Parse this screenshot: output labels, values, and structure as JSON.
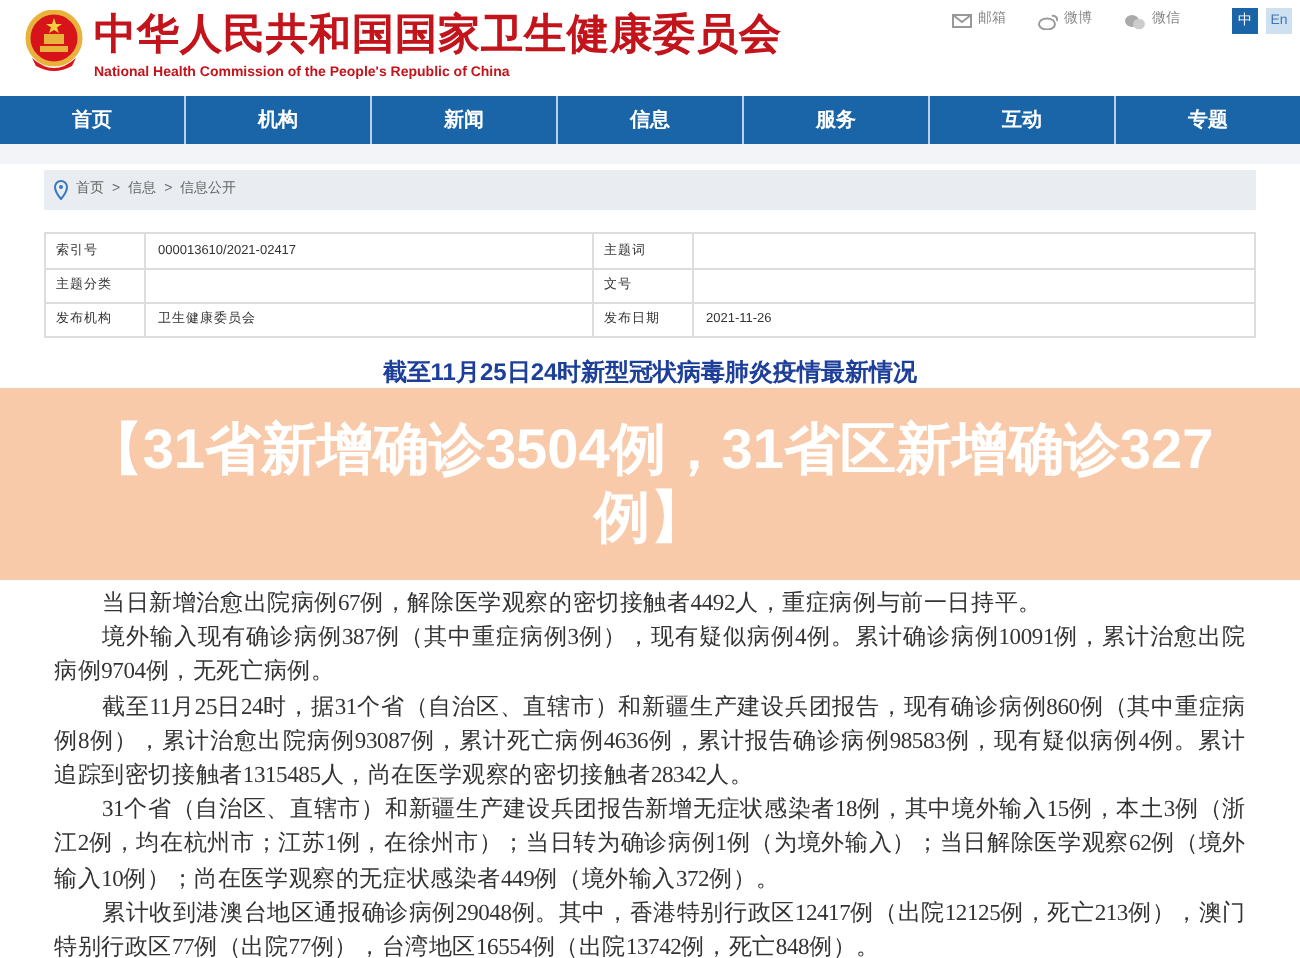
{
  "header": {
    "title": "中华人民共和国国家卫生健康委员会",
    "subtitle": "National Health Commission of the People's Republic of China",
    "links": [
      {
        "kind": "mail",
        "label": "邮箱"
      },
      {
        "kind": "weibo",
        "label": "微博"
      },
      {
        "kind": "wechat",
        "label": "微信"
      }
    ],
    "languages": [
      {
        "label": "中",
        "selected": true
      },
      {
        "label": "En",
        "selected": false
      }
    ]
  },
  "nav": [
    "首页",
    "机构",
    "新闻",
    "信息",
    "服务",
    "互动",
    "专题"
  ],
  "breadcrumb": {
    "separator": ">",
    "items": [
      "首页",
      "信息",
      "信息公开"
    ]
  },
  "meta_table": [
    [
      {
        "label": "索引号",
        "value": "000013610/2021-02417"
      },
      {
        "label": "主题词"
      }
    ],
    [
      {
        "label": "主题分类"
      },
      {
        "label": "文号"
      }
    ],
    [
      {
        "label": "发布机构",
        "value": "卫生健康委员会"
      },
      {
        "label": "发布日期",
        "value": "2021-11-26"
      }
    ]
  ],
  "article": {
    "title": "截至11月25日24时新型冠状病毒肺炎疫情最新情况",
    "banner": "【31省新增确诊3504例，31省区新增确诊327例】",
    "paragraphs": [
      "当日新增治愈出院病例67例，解除医学观察的密切接触者4492人，重症病例与前一日持平。",
      "境外输入现有确诊病例387例（其中重症病例3例），现有疑似病例4例。累计确诊病例10091例，累计治愈出院病例9704例，无死亡病例。",
      "截至11月25日24时，据31个省（自治区、直辖市）和新疆生产建设兵团报告，现有确诊病例860例（其中重症病例8例），累计治愈出院病例93087例，累计死亡病例4636例，累计报告确诊病例98583例，现有疑似病例4例。累计追踪到密切接触者1315485人，尚在医学观察的密切接触者28342人。",
      "31个省（自治区、直辖市）和新疆生产建设兵团报告新增无症状感染者18例，其中境外输入15例，本土3例（浙江2例，均在杭州市；江苏1例，在徐州市）；当日转为确诊病例1例（为境外输入）；当日解除医学观察62例（境外输入10例）；尚在医学观察的无症状感染者449例（境外输入372例）。",
      "累计收到港澳台地区通报确诊病例29048例。其中，香港特别行政区12417例（出院12125例，死亡213例），澳门特别行政区77例（出院77例），台湾地区16554例（出院13742例，死亡848例）。"
    ]
  }
}
